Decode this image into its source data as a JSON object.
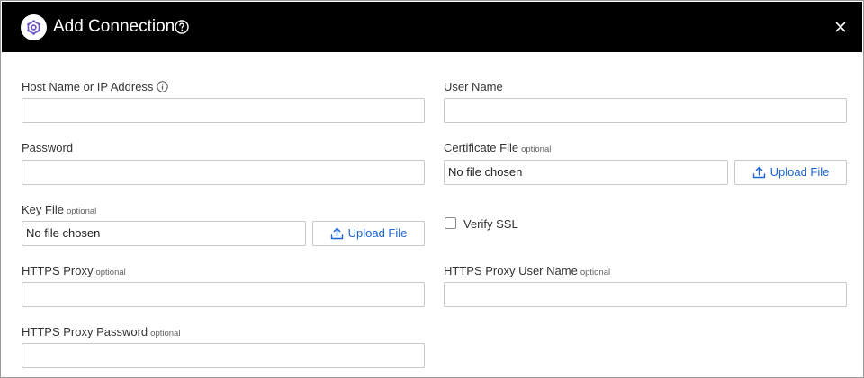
{
  "dialog": {
    "title": "Add Connection",
    "icons": {
      "logo": "gear-logo-icon",
      "help": "help-circle-icon",
      "close": "close-icon"
    }
  },
  "form": {
    "host": {
      "label": "Host Name or IP Address",
      "value": ""
    },
    "user_name": {
      "label": "User Name",
      "value": ""
    },
    "password": {
      "label": "Password",
      "value": ""
    },
    "certificate_file": {
      "label": "Certificate File",
      "optional": "optional",
      "file_status": "No file chosen",
      "button": "Upload File"
    },
    "key_file": {
      "label": "Key File",
      "optional": "optional",
      "file_status": "No file chosen",
      "button": "Upload File"
    },
    "verify_ssl": {
      "label": "Verify SSL",
      "checked": false
    },
    "https_proxy": {
      "label": "HTTPS Proxy",
      "optional": "optional",
      "value": ""
    },
    "https_proxy_user": {
      "label": "HTTPS Proxy User Name",
      "optional": "optional",
      "value": ""
    },
    "https_proxy_password": {
      "label": "HTTPS Proxy Password",
      "optional": "optional",
      "value": ""
    }
  },
  "colors": {
    "header_bg": "#000000",
    "link_blue": "#1a63d6",
    "logo_purple": "#6b4fc0"
  }
}
